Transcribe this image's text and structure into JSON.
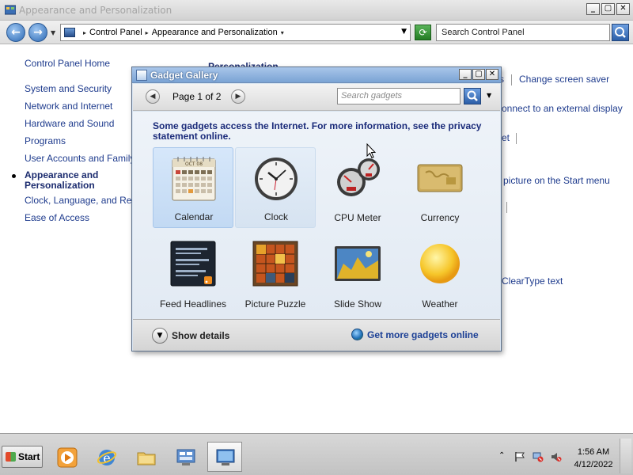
{
  "window": {
    "title": "Appearance and Personalization",
    "controls": [
      "_",
      "▢",
      "✕"
    ]
  },
  "address": {
    "crumbs": [
      "Control Panel",
      "Appearance and Personalization"
    ],
    "search_placeholder": "Search Control Panel"
  },
  "leftnav": {
    "home": "Control Panel Home",
    "items": [
      {
        "label": "System and Security"
      },
      {
        "label": "Network and Internet"
      },
      {
        "label": "Hardware and Sound"
      },
      {
        "label": "Programs"
      },
      {
        "label": "User Accounts and Family Sa"
      },
      {
        "label": "Appearance and Personalization",
        "current": true
      },
      {
        "label": "Clock, Language, and Regio"
      },
      {
        "label": "Ease of Access"
      }
    ]
  },
  "content_peek": {
    "header": "Personalization",
    "link_s": "s",
    "change_saver": "Change screen saver",
    "connect_display": "onnect to an external display",
    "et": "et",
    "start_menu": "picture on the Start menu",
    "cleartype": "ClearType text"
  },
  "gallery": {
    "title": "Gadget Gallery",
    "page_label": "Page 1 of 2",
    "search_placeholder": "Search gadgets",
    "notice": "Some gadgets access the Internet.  For more information, see the privacy statement online.",
    "gadgets": [
      {
        "label": "Calendar",
        "icon": "calendar-gadget-icon",
        "state": "selected"
      },
      {
        "label": "Clock",
        "icon": "clock-gadget-icon",
        "state": "hover"
      },
      {
        "label": "CPU Meter",
        "icon": "cpu-meter-gadget-icon",
        "state": ""
      },
      {
        "label": "Currency",
        "icon": "currency-gadget-icon",
        "state": ""
      },
      {
        "label": "Feed Headlines",
        "icon": "feed-headlines-gadget-icon",
        "state": ""
      },
      {
        "label": "Picture Puzzle",
        "icon": "picture-puzzle-gadget-icon",
        "state": ""
      },
      {
        "label": "Slide Show",
        "icon": "slide-show-gadget-icon",
        "state": ""
      },
      {
        "label": "Weather",
        "icon": "weather-gadget-icon",
        "state": ""
      }
    ],
    "show_details": "Show details",
    "get_more": "Get more gadgets online",
    "calendar_month": "OCT 08"
  },
  "taskbar": {
    "start_label": "Start",
    "time": "1:56 AM",
    "date": "4/12/2022"
  }
}
